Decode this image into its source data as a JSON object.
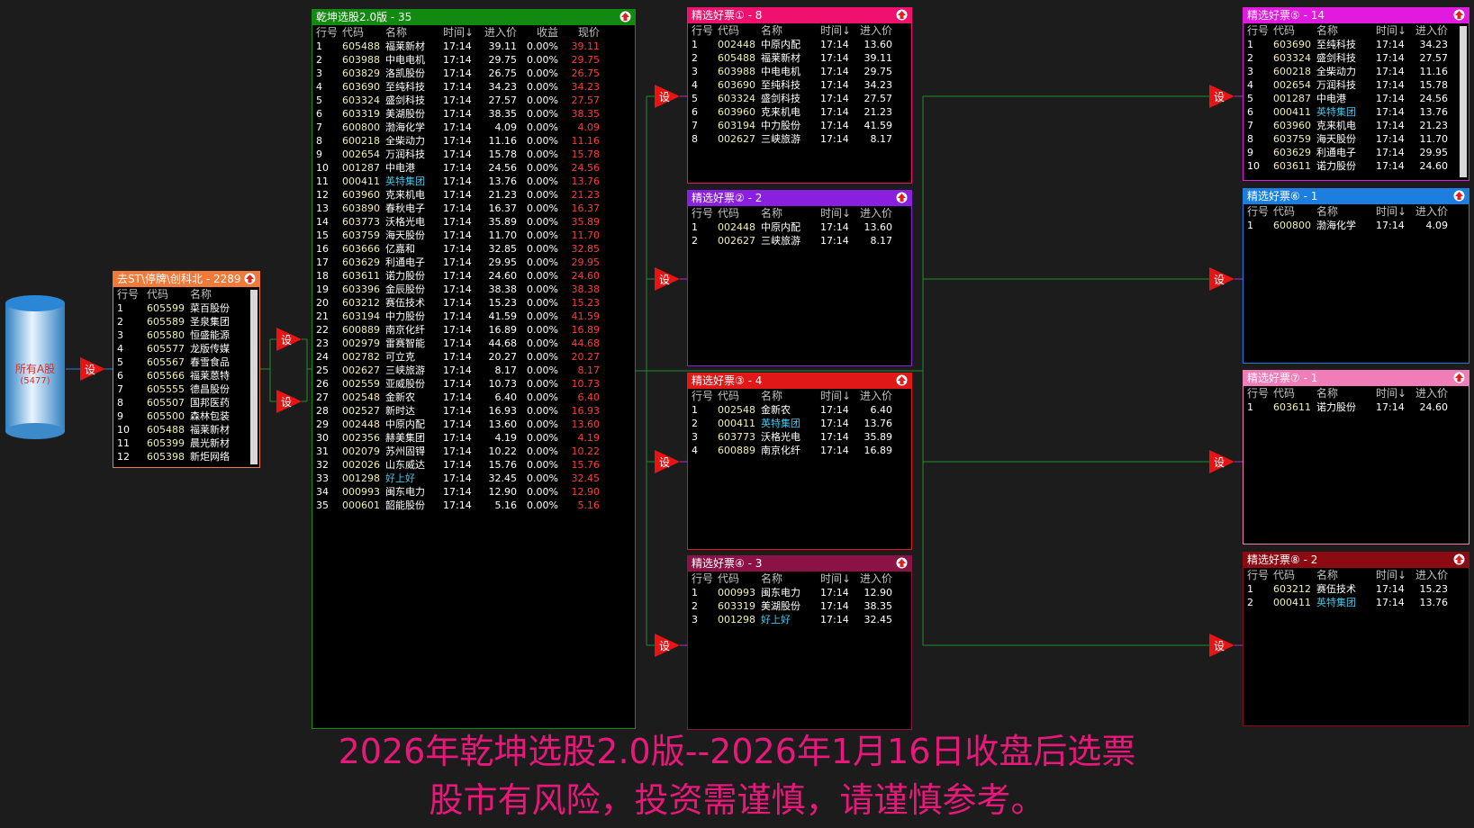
{
  "source": {
    "title": "所有A股",
    "count": "(5477)"
  },
  "set_label": "设",
  "filter_panel": {
    "title": "去ST\\停牌\\创科北 - 2289",
    "headers": [
      "行号",
      "代码",
      "名称"
    ],
    "rows": [
      [
        "1",
        "605599",
        "菜百股份"
      ],
      [
        "2",
        "605589",
        "圣泉集团"
      ],
      [
        "3",
        "605580",
        "恒盛能源"
      ],
      [
        "4",
        "605577",
        "龙版传媒"
      ],
      [
        "5",
        "605567",
        "春雪食品"
      ],
      [
        "6",
        "605566",
        "福莱蒽特"
      ],
      [
        "7",
        "605555",
        "德昌股份"
      ],
      [
        "8",
        "605507",
        "国邦医药"
      ],
      [
        "9",
        "605500",
        "森林包装"
      ],
      [
        "10",
        "605488",
        "福莱新材"
      ],
      [
        "11",
        "605399",
        "晨光新材"
      ],
      [
        "12",
        "605398",
        "新炬网络"
      ]
    ]
  },
  "main_panel": {
    "title": "乾坤选股2.0版 - 35",
    "headers": [
      "行号",
      "代码",
      "名称",
      "时间↓",
      "进入价",
      "收益",
      "现价"
    ],
    "rows": [
      [
        "1",
        "605488",
        "福莱新材",
        "17:14",
        "39.11",
        "0.00%",
        "39.11"
      ],
      [
        "2",
        "603988",
        "中电电机",
        "17:14",
        "29.75",
        "0.00%",
        "29.75"
      ],
      [
        "3",
        "603829",
        "洛凯股份",
        "17:14",
        "26.75",
        "0.00%",
        "26.75"
      ],
      [
        "4",
        "603690",
        "至纯科技",
        "17:14",
        "34.23",
        "0.00%",
        "34.23"
      ],
      [
        "5",
        "603324",
        "盛剑科技",
        "17:14",
        "27.57",
        "0.00%",
        "27.57"
      ],
      [
        "6",
        "603319",
        "美湖股份",
        "17:14",
        "38.35",
        "0.00%",
        "38.35"
      ],
      [
        "7",
        "600800",
        "渤海化学",
        "17:14",
        "4.09",
        "0.00%",
        "4.09"
      ],
      [
        "8",
        "600218",
        "全柴动力",
        "17:14",
        "11.16",
        "0.00%",
        "11.16"
      ],
      [
        "9",
        "002654",
        "万润科技",
        "17:14",
        "15.78",
        "0.00%",
        "15.78"
      ],
      [
        "10",
        "001287",
        "中电港",
        "17:14",
        "24.56",
        "0.00%",
        "24.56"
      ],
      [
        "11",
        "000411",
        "英特集团",
        "17:14",
        "13.76",
        "0.00%",
        "13.76"
      ],
      [
        "12",
        "603960",
        "克来机电",
        "17:14",
        "21.23",
        "0.00%",
        "21.23"
      ],
      [
        "13",
        "603890",
        "春秋电子",
        "17:14",
        "16.37",
        "0.00%",
        "16.37"
      ],
      [
        "14",
        "603773",
        "沃格光电",
        "17:14",
        "35.89",
        "0.00%",
        "35.89"
      ],
      [
        "15",
        "603759",
        "海天股份",
        "17:14",
        "11.70",
        "0.00%",
        "11.70"
      ],
      [
        "16",
        "603666",
        "亿嘉和",
        "17:14",
        "32.85",
        "0.00%",
        "32.85"
      ],
      [
        "17",
        "603629",
        "利通电子",
        "17:14",
        "29.95",
        "0.00%",
        "29.95"
      ],
      [
        "18",
        "603611",
        "诺力股份",
        "17:14",
        "24.60",
        "0.00%",
        "24.60"
      ],
      [
        "19",
        "603396",
        "金辰股份",
        "17:14",
        "38.38",
        "0.00%",
        "38.38"
      ],
      [
        "20",
        "603212",
        "赛伍技术",
        "17:14",
        "15.23",
        "0.00%",
        "15.23"
      ],
      [
        "21",
        "603194",
        "中力股份",
        "17:14",
        "41.59",
        "0.00%",
        "41.59"
      ],
      [
        "22",
        "600889",
        "南京化纤",
        "17:14",
        "16.89",
        "0.00%",
        "16.89"
      ],
      [
        "23",
        "002979",
        "雷赛智能",
        "17:14",
        "44.68",
        "0.00%",
        "44.68"
      ],
      [
        "24",
        "002782",
        "可立克",
        "17:14",
        "20.27",
        "0.00%",
        "20.27"
      ],
      [
        "25",
        "002627",
        "三峡旅游",
        "17:14",
        "8.17",
        "0.00%",
        "8.17"
      ],
      [
        "26",
        "002559",
        "亚威股份",
        "17:14",
        "10.73",
        "0.00%",
        "10.73"
      ],
      [
        "27",
        "002548",
        "金新农",
        "17:14",
        "6.40",
        "0.00%",
        "6.40"
      ],
      [
        "28",
        "002527",
        "新时达",
        "17:14",
        "16.93",
        "0.00%",
        "16.93"
      ],
      [
        "29",
        "002448",
        "中原内配",
        "17:14",
        "13.60",
        "0.00%",
        "13.60"
      ],
      [
        "30",
        "002356",
        "赫美集团",
        "17:14",
        "4.19",
        "0.00%",
        "4.19"
      ],
      [
        "31",
        "002079",
        "苏州固锝",
        "17:14",
        "10.22",
        "0.00%",
        "10.22"
      ],
      [
        "32",
        "002026",
        "山东威达",
        "17:14",
        "15.76",
        "0.00%",
        "15.76"
      ],
      [
        "33",
        "001298",
        "好上好",
        "17:14",
        "32.45",
        "0.00%",
        "32.45"
      ],
      [
        "34",
        "000993",
        "闽东电力",
        "17:14",
        "12.90",
        "0.00%",
        "12.90"
      ],
      [
        "35",
        "000601",
        "韶能股份",
        "17:14",
        "5.16",
        "0.00%",
        "5.16"
      ]
    ]
  },
  "sub_headers": [
    "行号",
    "代码",
    "名称",
    "时间↓",
    "进入价"
  ],
  "sub_panels": [
    {
      "title": "精选好票① - 8",
      "color": "#f0116e",
      "rows": [
        [
          "1",
          "002448",
          "中原内配",
          "17:14",
          "13.60"
        ],
        [
          "2",
          "605488",
          "福莱新材",
          "17:14",
          "39.11"
        ],
        [
          "3",
          "603988",
          "中电电机",
          "17:14",
          "29.75"
        ],
        [
          "4",
          "603690",
          "至纯科技",
          "17:14",
          "34.23"
        ],
        [
          "5",
          "603324",
          "盛剑科技",
          "17:14",
          "27.57"
        ],
        [
          "6",
          "603960",
          "克来机电",
          "17:14",
          "21.23"
        ],
        [
          "7",
          "603194",
          "中力股份",
          "17:14",
          "41.59"
        ],
        [
          "8",
          "002627",
          "三峡旅游",
          "17:14",
          "8.17"
        ]
      ]
    },
    {
      "title": "精选好票② - 2",
      "color": "#8a1fe0",
      "rows": [
        [
          "1",
          "002448",
          "中原内配",
          "17:14",
          "13.60"
        ],
        [
          "2",
          "002627",
          "三峡旅游",
          "17:14",
          "8.17"
        ]
      ]
    },
    {
      "title": "精选好票③ - 4",
      "color": "#e01818",
      "rows": [
        [
          "1",
          "002548",
          "金新农",
          "17:14",
          "6.40"
        ],
        [
          "2",
          "000411",
          "英特集团",
          "17:14",
          "13.76"
        ],
        [
          "3",
          "603773",
          "沃格光电",
          "17:14",
          "35.89"
        ],
        [
          "4",
          "600889",
          "南京化纤",
          "17:14",
          "16.89"
        ]
      ]
    },
    {
      "title": "精选好票④ - 3",
      "color": "#8c1245",
      "rows": [
        [
          "1",
          "000993",
          "闽东电力",
          "17:14",
          "12.90"
        ],
        [
          "2",
          "603319",
          "美湖股份",
          "17:14",
          "38.35"
        ],
        [
          "3",
          "001298",
          "好上好",
          "17:14",
          "32.45"
        ]
      ]
    },
    {
      "title": "精选好票⑤ - 14",
      "color": "#e21ae0",
      "rows": [
        [
          "1",
          "603690",
          "至纯科技",
          "17:14",
          "34.23"
        ],
        [
          "2",
          "603324",
          "盛剑科技",
          "17:14",
          "27.57"
        ],
        [
          "3",
          "600218",
          "全柴动力",
          "17:14",
          "11.16"
        ],
        [
          "4",
          "002654",
          "万润科技",
          "17:14",
          "15.78"
        ],
        [
          "5",
          "001287",
          "中电港",
          "17:14",
          "24.56"
        ],
        [
          "6",
          "000411",
          "英特集团",
          "17:14",
          "13.76"
        ],
        [
          "7",
          "603960",
          "克来机电",
          "17:14",
          "21.23"
        ],
        [
          "8",
          "603759",
          "海天股份",
          "17:14",
          "11.70"
        ],
        [
          "9",
          "603629",
          "利通电子",
          "17:14",
          "29.95"
        ],
        [
          "10",
          "603611",
          "诺力股份",
          "17:14",
          "24.60"
        ]
      ]
    },
    {
      "title": "精选好票⑥ - 1",
      "color": "#1c7fe0",
      "rows": [
        [
          "1",
          "600800",
          "渤海化学",
          "17:14",
          "4.09"
        ]
      ]
    },
    {
      "title": "精选好票⑦ - 1",
      "color": "#f07cb8",
      "rows": [
        [
          "1",
          "603611",
          "诺力股份",
          "17:14",
          "24.60"
        ]
      ]
    },
    {
      "title": "精选好票⑧ - 2",
      "color": "#8c0a12",
      "rows": [
        [
          "1",
          "603212",
          "赛伍技术",
          "17:14",
          "15.23"
        ],
        [
          "2",
          "000411",
          "英特集团",
          "17:14",
          "13.76"
        ]
      ]
    }
  ],
  "footer": {
    "line1": "2026年乾坤选股2.0版--2026年1月16日收盘后选票",
    "line2": "股市有风险，投资需谨慎，请谨慎参考。"
  },
  "colors": {
    "filter_title": "#f07a3a",
    "main_title": "#128a12",
    "cyan_name": "#3ec9ee",
    "price_red": "#ff3b3b",
    "footer": "#e8187b"
  }
}
